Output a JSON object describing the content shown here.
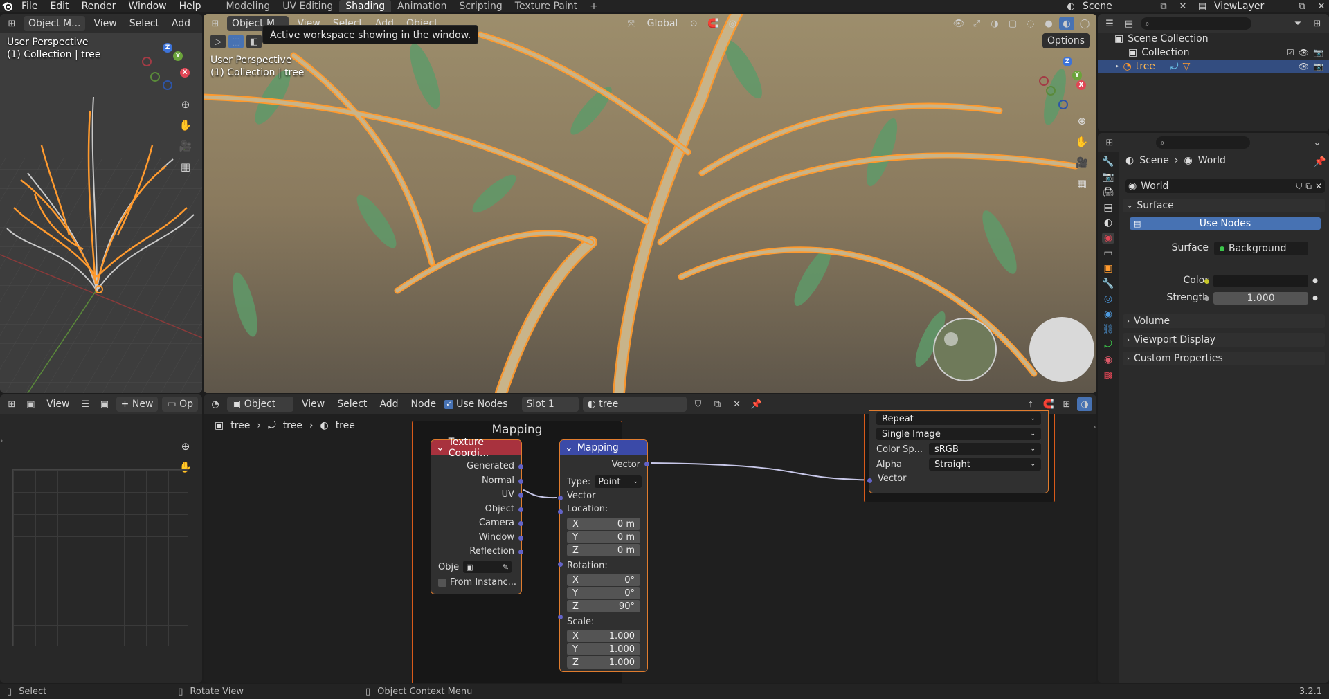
{
  "topbar": {
    "menus": [
      "File",
      "Edit",
      "Render",
      "Window",
      "Help"
    ],
    "workspaces": [
      "Modeling",
      "UV Editing",
      "Shading",
      "Animation",
      "Scripting",
      "Texture Paint"
    ],
    "active_workspace": "Shading",
    "add_tab": "+",
    "scene_label": "Scene",
    "viewlayer_label": "ViewLayer"
  },
  "tooltip": "Active workspace showing in the window.",
  "left_viewport": {
    "mode": "Object M...",
    "menus": [
      "View",
      "Select",
      "Add"
    ],
    "overlay_line1": "User Perspective",
    "overlay_line2": "(1) Collection | tree",
    "gizmo": {
      "x": "X",
      "y": "Y",
      "z": "Z"
    }
  },
  "main_viewport": {
    "mode": "Object M...",
    "menus": [
      "View",
      "Select",
      "Add",
      "Object"
    ],
    "orientation": "Global",
    "options_label": "Options",
    "overlay_line1": "User Perspective",
    "overlay_line2": "(1) Collection | tree",
    "gizmo": {
      "x": "X",
      "y": "Y",
      "z": "Z"
    }
  },
  "image_editor": {
    "view_menu": "View",
    "new_button": "New",
    "open_button": "Op"
  },
  "node_editor": {
    "mode": "Object",
    "menus": [
      "View",
      "Select",
      "Add",
      "Node"
    ],
    "use_nodes_label": "Use Nodes",
    "slot": "Slot 1",
    "material": "tree",
    "breadcrumb": [
      "tree",
      "tree",
      "tree"
    ],
    "frame_label": "Mapping",
    "texcoord_node": {
      "title": "Texture Coordi...",
      "outputs": [
        "Generated",
        "Normal",
        "UV",
        "Object",
        "Camera",
        "Window",
        "Reflection"
      ],
      "object_label": "Obje",
      "from_instancer": "From Instanc..."
    },
    "mapping_node": {
      "title": "Mapping",
      "output": "Vector",
      "type_label": "Type:",
      "type_value": "Point",
      "vector_input": "Vector",
      "location_label": "Location:",
      "location": [
        {
          "axis": "X",
          "value": "0 m"
        },
        {
          "axis": "Y",
          "value": "0 m"
        },
        {
          "axis": "Z",
          "value": "0 m"
        }
      ],
      "rotation_label": "Rotation:",
      "rotation": [
        {
          "axis": "X",
          "value": "0°"
        },
        {
          "axis": "Y",
          "value": "0°"
        },
        {
          "axis": "Z",
          "value": "90°"
        }
      ],
      "scale_label": "Scale:",
      "scale": [
        {
          "axis": "X",
          "value": "1.000"
        },
        {
          "axis": "Y",
          "value": "1.000"
        },
        {
          "axis": "Z",
          "value": "1.000"
        }
      ]
    },
    "image_node": {
      "extension": "Repeat",
      "source": "Single Image",
      "colorspace_label": "Color Sp...",
      "colorspace_value": "sRGB",
      "alpha_label": "Alpha",
      "alpha_value": "Straight",
      "vector_input": "Vector"
    }
  },
  "outliner": {
    "root": "Scene Collection",
    "collection": "Collection",
    "object": "tree"
  },
  "properties": {
    "breadcrumb_scene": "Scene",
    "breadcrumb_world": "World",
    "world_name": "World",
    "surface_section": "Surface",
    "use_nodes": "Use Nodes",
    "surface_label": "Surface",
    "surface_value": "Background",
    "color_label": "Color",
    "strength_label": "Strength",
    "strength_value": "1.000",
    "volume_section": "Volume",
    "viewport_display_section": "Viewport Display",
    "custom_props_section": "Custom Properties"
  },
  "statusbar": {
    "select": "Select",
    "rotate": "Rotate View",
    "context": "Object Context Menu",
    "version": "3.2.1"
  },
  "colors": {
    "accent_blue": "#4772b3",
    "selection_orange": "#ff9a2e",
    "node_header_red": "#a8323e",
    "node_header_blue": "#3b4aa8"
  }
}
